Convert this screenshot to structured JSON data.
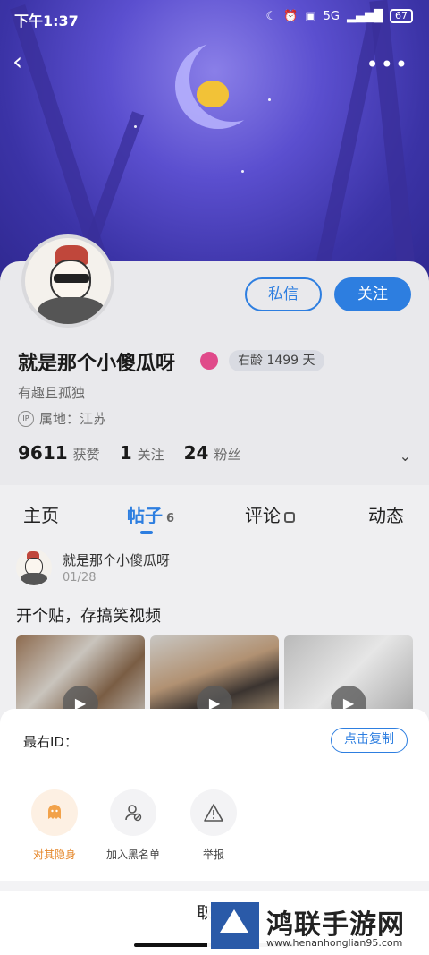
{
  "status_bar": {
    "time": "下午1:37",
    "icons": [
      "moon-icon",
      "alarm-icon",
      "hd-icon",
      "5g-signal-icon"
    ],
    "network": "5G",
    "battery": "67"
  },
  "nav": {
    "back_icon": "chevron-left-icon",
    "more_icon": "more-dots-icon"
  },
  "profile": {
    "username": "就是那个小傻瓜呀",
    "age_tag": "右龄 1499 天",
    "bio": "有趣且孤独",
    "ip_label": "IP",
    "location": "属地：江苏",
    "buttons": {
      "message": "私信",
      "follow": "关注"
    },
    "stats": [
      {
        "value": "9611",
        "label": "获赞"
      },
      {
        "value": "1",
        "label": "关注"
      },
      {
        "value": "24",
        "label": "粉丝"
      }
    ]
  },
  "tabs": [
    {
      "label": "主页"
    },
    {
      "label": "帖子",
      "count": "6",
      "active": true
    },
    {
      "label": "评论"
    },
    {
      "label": "动态"
    }
  ],
  "post": {
    "author": "就是那个小傻瓜呀",
    "date": "01/28",
    "title": "开个贴，存搞笑视频"
  },
  "sheet": {
    "id_label": "最右ID：",
    "copy_button": "点击复制",
    "actions": [
      {
        "label": "对其隐身",
        "icon": "ghost-icon"
      },
      {
        "label": "加入黑名单",
        "icon": "block-user-icon"
      },
      {
        "label": "举报",
        "icon": "warning-icon"
      }
    ],
    "cancel_partial": "取"
  },
  "watermark": {
    "title": "鸿联手游网",
    "url": "www.henanhonglian95.com"
  },
  "colors": {
    "accent": "#2d7ee0",
    "hide_orange": "#e6892e",
    "banner": "#5b4fcf"
  }
}
